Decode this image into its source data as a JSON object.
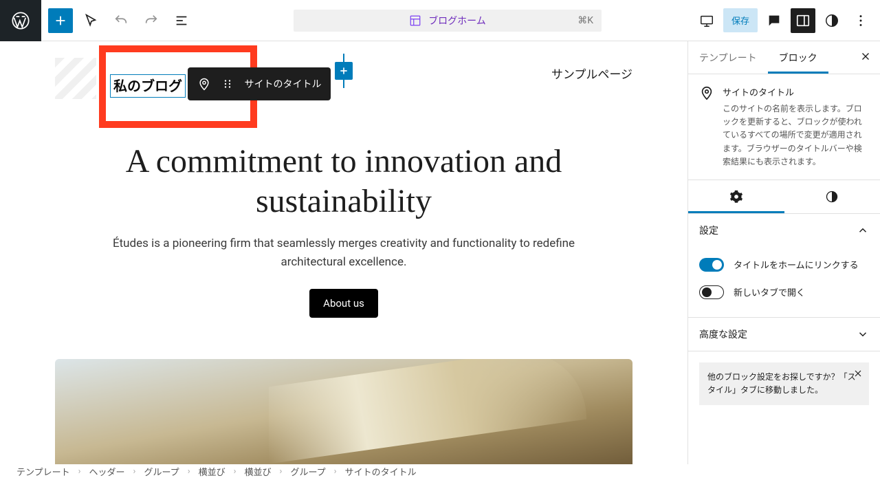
{
  "top": {
    "doc_title": "ブログホーム",
    "kbd": "⌘K",
    "save": "保存"
  },
  "header": {
    "site_title": "私のブログ",
    "block_toolbar_label": "サイトのタイトル",
    "nav_link": "サンプルページ"
  },
  "hero": {
    "heading": "A commitment to innovation and sustainability",
    "paragraph": "Études is a pioneering firm that seamlessly merges creativity and functionality to redefine architectural excellence.",
    "cta": "About us"
  },
  "sidebar": {
    "tabs": {
      "template": "テンプレート",
      "block": "ブロック"
    },
    "block_title": "サイトのタイトル",
    "block_desc": "このサイトの名前を表示します。ブロックを更新すると、ブロックが使われているすべての場所で変更が適用されます。ブラウザーのタイトルバーや検索結果にも表示されます。",
    "panel_settings": "設定",
    "opt_link_home": "タイトルをホームにリンクする",
    "opt_new_tab": "新しいタブで開く",
    "panel_advanced": "高度な設定",
    "hint": "他のブロック設定をお探しですか？「スタイル」タブに移動しました。"
  },
  "breadcrumb": [
    "テンプレート",
    "ヘッダー",
    "グループ",
    "横並び",
    "横並び",
    "グループ",
    "サイトのタイトル"
  ]
}
